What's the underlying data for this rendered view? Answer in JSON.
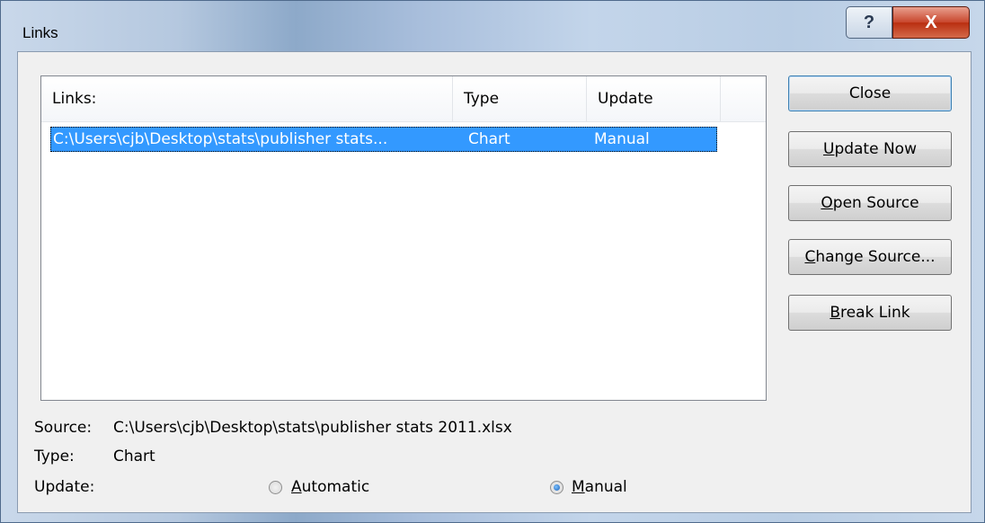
{
  "window": {
    "title": "Links",
    "help_label": "?",
    "close_label": "X"
  },
  "list": {
    "columns": [
      "Links:",
      "Type",
      "Update"
    ],
    "rows": [
      {
        "link": "C:\\Users\\cjb\\Desktop\\stats\\publisher stats...",
        "type": "Chart",
        "update": "Manual"
      }
    ]
  },
  "buttons": {
    "close": "Close",
    "update_now": "Update Now",
    "open_source": "Open Source",
    "change_source": "Change Source...",
    "break_link": "Break Link"
  },
  "details": {
    "source_label": "Source:",
    "source_value": "C:\\Users\\cjb\\Desktop\\stats\\publisher stats 2011.xlsx",
    "type_label": "Type:",
    "type_value": "Chart",
    "update_label": "Update:",
    "automatic_label": "Automatic",
    "manual_label": "Manual",
    "selected_update": "Manual"
  }
}
